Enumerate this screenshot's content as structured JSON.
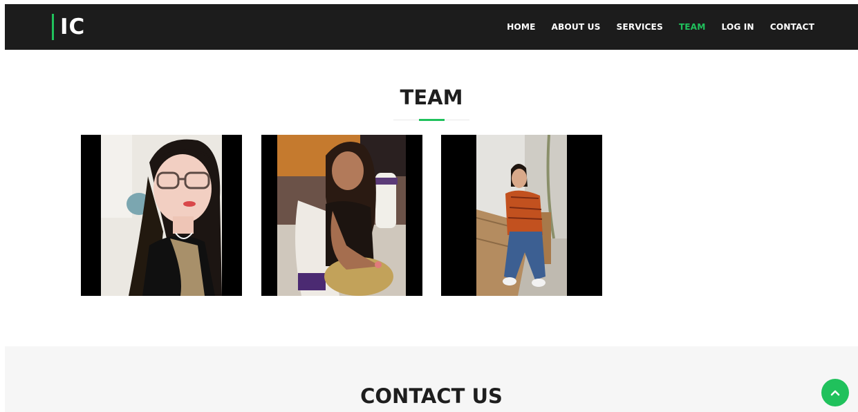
{
  "header": {
    "logo_text": "IC",
    "nav": [
      {
        "label": "HOME"
      },
      {
        "label": "ABOUT US"
      },
      {
        "label": "SERVICES"
      },
      {
        "label": "TEAM",
        "active": true
      },
      {
        "label": "LOG IN"
      },
      {
        "label": "CONTACT"
      }
    ]
  },
  "team": {
    "title": "TEAM",
    "members": [
      {
        "photo": "portrait-woman-glasses"
      },
      {
        "photo": "portrait-woman-seated-event"
      },
      {
        "photo": "portrait-woman-at-table"
      }
    ]
  },
  "contact": {
    "title": "CONTACT US"
  },
  "icons": {
    "back_to_top": "chevron-up-icon"
  },
  "colors": {
    "accent": "#20c15c",
    "navbar": "#1c1c1c",
    "contact_bg": "#f6f6f6"
  }
}
